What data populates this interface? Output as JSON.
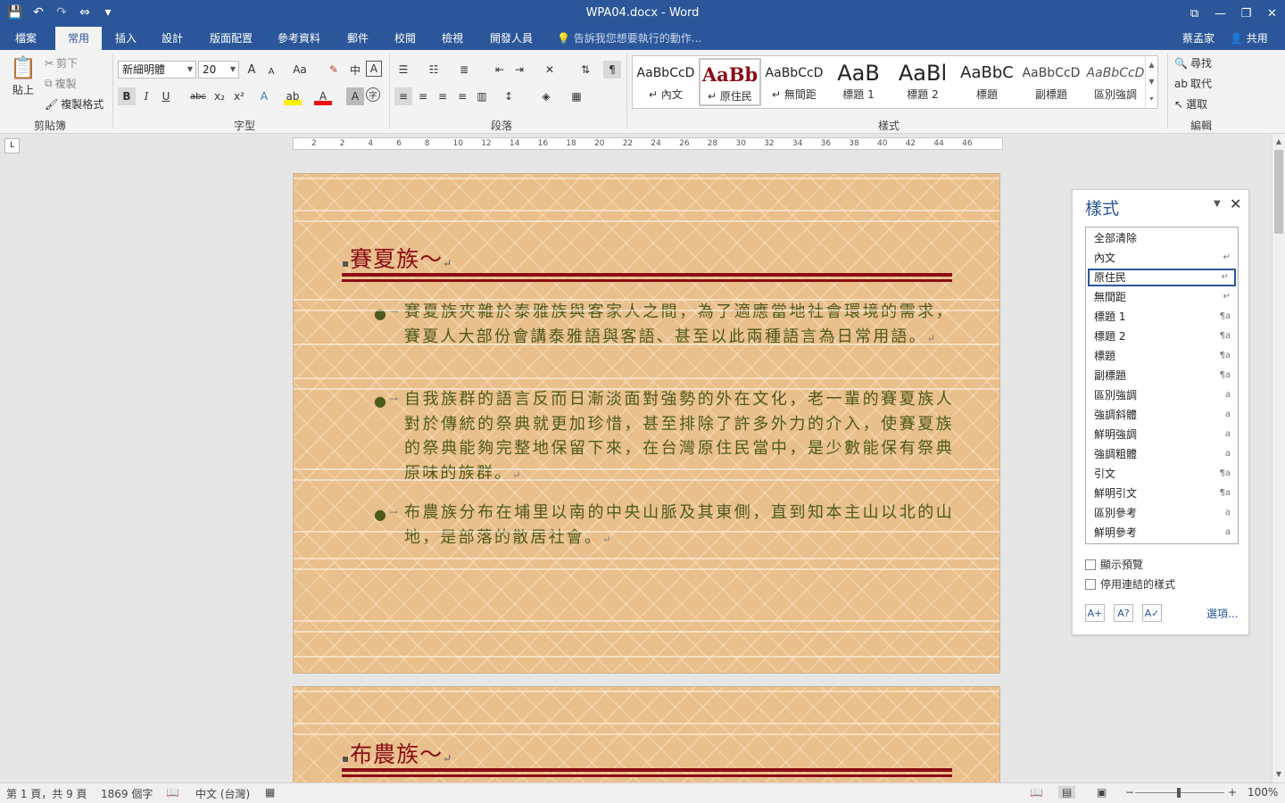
{
  "titlebar": {
    "title": "WPA04.docx - Word",
    "qat": {
      "save": "💾",
      "undo": "↶",
      "redo": "↷",
      "touch": "⇔",
      "customize": "▾"
    },
    "win": {
      "restore_ribbon": "⧉",
      "minimize": "—",
      "maximize": "❐",
      "close": "✕"
    }
  },
  "tabs": {
    "items": [
      "檔案",
      "常用",
      "插入",
      "設計",
      "版面配置",
      "參考資料",
      "郵件",
      "校閱",
      "檢視",
      "開發人員"
    ],
    "active": "常用",
    "tell_me": "告訴我您想要執行的動作...",
    "user": "蔡孟家",
    "share": "共用"
  },
  "ribbon": {
    "clipboard": {
      "label": "剪貼簿",
      "paste": "貼上",
      "cut": "剪下",
      "copy": "複製",
      "format_painter": "複製格式"
    },
    "font": {
      "label": "字型",
      "name": "新細明體",
      "size": "20",
      "grow": "A",
      "shrink": "A",
      "case": "Aa",
      "bold": "B",
      "italic": "I",
      "underline": "U",
      "strike": "abc",
      "sub": "x₂",
      "sup": "x²"
    },
    "paragraph": {
      "label": "段落"
    },
    "styles": {
      "label": "樣式",
      "items": [
        {
          "preview": "AaBbCcD",
          "name": "內文"
        },
        {
          "preview": "AaBb",
          "name": "原住民"
        },
        {
          "preview": "AaBbCcD",
          "name": "無間距"
        },
        {
          "preview": "AaB",
          "name": "標題 1"
        },
        {
          "preview": "AaBl",
          "name": "標題 2"
        },
        {
          "preview": "AaBbC",
          "name": "標題"
        },
        {
          "preview": "AaBbCcD",
          "name": "副標題"
        },
        {
          "preview": "AaBbCcD",
          "name": "區別強調"
        }
      ]
    },
    "editing": {
      "label": "編輯",
      "find": "尋找",
      "replace": "取代",
      "select": "選取"
    }
  },
  "ruler": {
    "marks": [
      "2",
      "2",
      "4",
      "6",
      "8",
      "10",
      "12",
      "14",
      "16",
      "18",
      "20",
      "22",
      "24",
      "26",
      "28",
      "30",
      "32",
      "34",
      "36",
      "38",
      "40",
      "42",
      "44",
      "46"
    ],
    "tab_selector": "L"
  },
  "document": {
    "page1": {
      "heading": "賽夏族～",
      "bullets": [
        "賽夏族夾雜於泰雅族與客家人之間，為了適應當地社會環境的需求，賽夏人大部份會講泰雅語與客語、甚至以此兩種語言為日常用語。",
        "自我族群的語言反而日漸淡面對強勢的外在文化，老一輩的賽夏族人對於傳統的祭典就更加珍惜，甚至排除了許多外力的介入，使賽夏族的祭典能夠完整地保留下來，在台灣原住民當中，是少數能保有祭典原味的族群。",
        "布農族分布在埔里以南的中央山脈及其東側，直到知本主山以北的山地，是部落的散居社會。"
      ]
    },
    "page2": {
      "heading": "布農族～"
    },
    "para_mark": "↵",
    "tab_arrow": "→",
    "bullet_char": "●",
    "colors": {
      "heading": "#8b0c14",
      "body": "#4e5a1c",
      "page_bg": "#e9bf8b"
    }
  },
  "styles_pane": {
    "title": "樣式",
    "items": [
      {
        "name": "全部清除",
        "icon": ""
      },
      {
        "name": "內文",
        "icon": "↵"
      },
      {
        "name": "原住民",
        "icon": "↵"
      },
      {
        "name": "無間距",
        "icon": "↵"
      },
      {
        "name": "標題 1",
        "icon": "¶a"
      },
      {
        "name": "標題 2",
        "icon": "¶a"
      },
      {
        "name": "標題",
        "icon": "¶a"
      },
      {
        "name": "副標題",
        "icon": "¶a"
      },
      {
        "name": "區別強調",
        "icon": "a"
      },
      {
        "name": "強調斜體",
        "icon": "a"
      },
      {
        "name": "鮮明強調",
        "icon": "a"
      },
      {
        "name": "強調粗體",
        "icon": "a"
      },
      {
        "name": "引文",
        "icon": "¶a"
      },
      {
        "name": "鮮明引文",
        "icon": "¶a"
      },
      {
        "name": "區別參考",
        "icon": "a"
      },
      {
        "name": "鮮明參考",
        "icon": "a"
      }
    ],
    "selected": "原住民",
    "show_preview": "顯示預覽",
    "disable_linked": "停用連結的樣式",
    "options": "選項..."
  },
  "status": {
    "page": "第 1 頁，共 9 頁",
    "words": "1869 個字",
    "language": "中文 (台灣)",
    "zoom": "100%",
    "zoom_minus": "−",
    "zoom_plus": "+"
  }
}
